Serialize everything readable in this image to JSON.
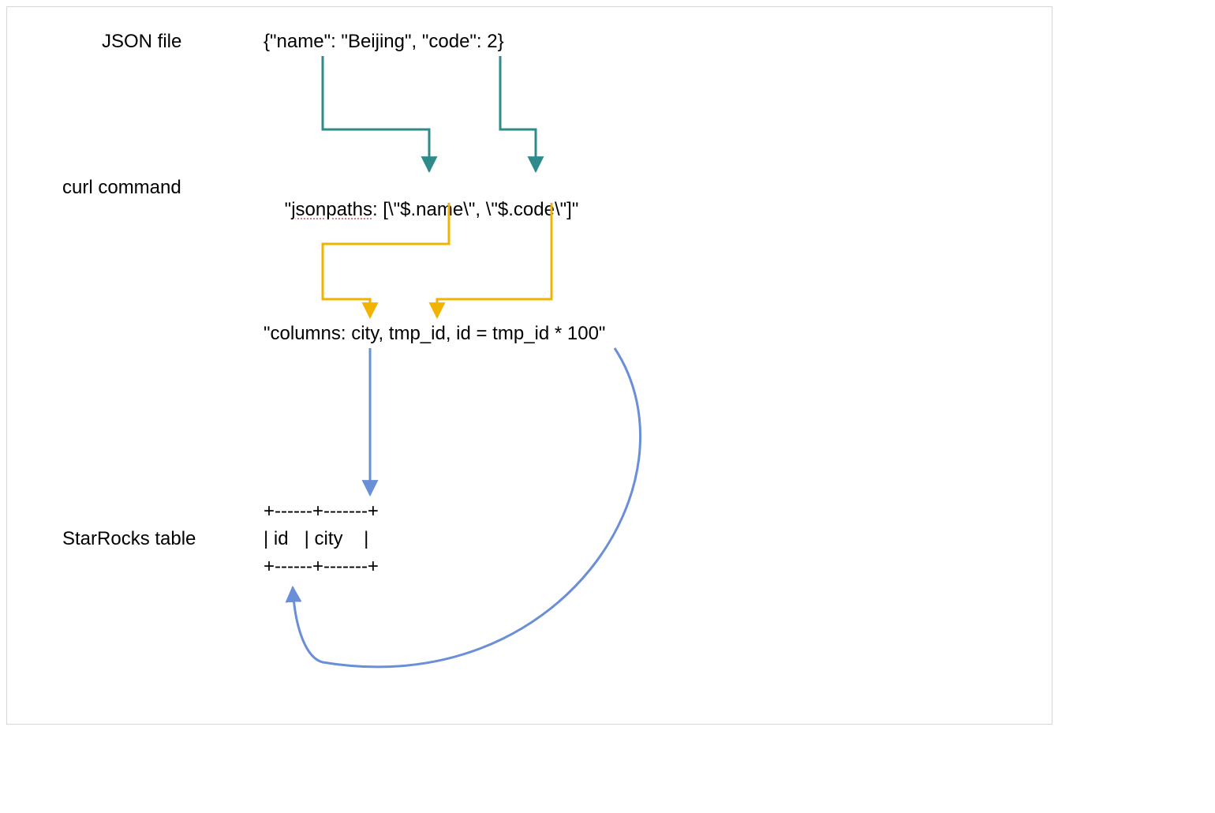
{
  "labels": {
    "json_file": "JSON file",
    "curl_command": "curl command",
    "starrocks_table": "StarRocks table"
  },
  "content": {
    "json_file": "{\"name\": \"Beijing\", \"code\": 2}",
    "jsonpaths_prefix": "\"",
    "jsonpaths_word": "jsonpaths",
    "jsonpaths_suffix": ": [\\\"$.name\\\", \\\"$.code\\\"]\"",
    "columns": "\"columns: city, tmp_id, id = tmp_id * 100\"",
    "table_border": "+------+-------+",
    "table_row": "| id   | city    |"
  },
  "colors": {
    "teal": "#2f8b8b",
    "yellow": "#f0b400",
    "blue": "#6a8fd8"
  }
}
